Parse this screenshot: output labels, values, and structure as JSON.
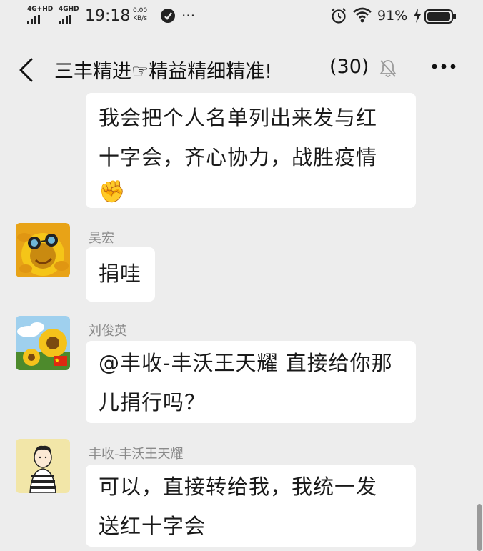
{
  "status_bar": {
    "network1": "4G+HD",
    "network2": "4GHD",
    "time": "19:18",
    "speed_value": "0.00",
    "speed_unit": "KB/s",
    "more": "···",
    "battery": "91%"
  },
  "header": {
    "title": "三丰精进☞精益精细精准!",
    "count": "(30)"
  },
  "messages": [
    {
      "sender": "",
      "lines": [
        "我会把个人名单列出来发与红",
        "十字会，齐心协力，战胜疫情"
      ],
      "emoji": "✊"
    },
    {
      "sender": "吴宏",
      "lines": [
        "捐哇"
      ]
    },
    {
      "sender": "刘俊英",
      "lines": [
        "@丰收-丰沃王天耀  直接给你那",
        "儿捐行吗？"
      ]
    },
    {
      "sender": "丰收-丰沃王天耀",
      "lines": [
        "可以，直接转给我，我统一发",
        "送红十字会"
      ]
    }
  ],
  "colors": {
    "background": "#ededed",
    "bubble": "#ffffff",
    "sender": "#8a8a8a"
  }
}
